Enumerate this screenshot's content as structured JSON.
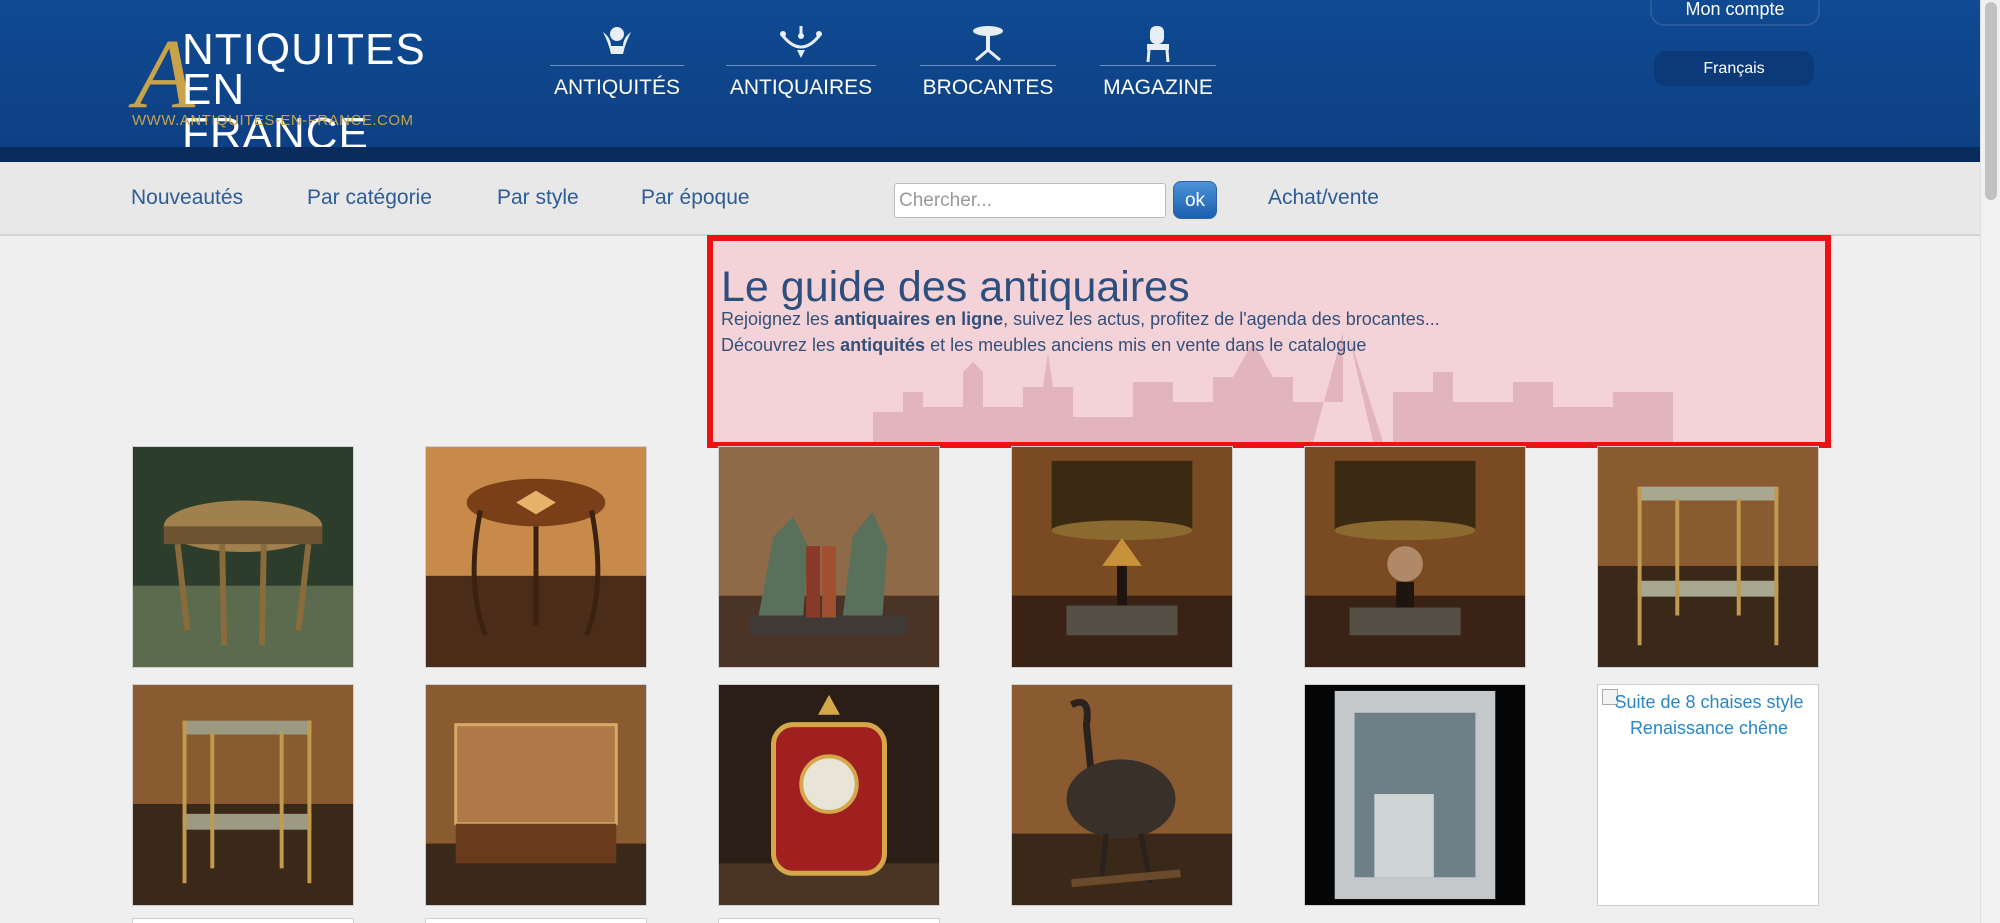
{
  "header": {
    "logo": {
      "initial": "A",
      "line1": "NTIQUITES",
      "line2": "EN FRANCE",
      "url": "WWW.ANTIQUITES-EN-FRANCE.COM"
    },
    "nav": [
      {
        "label": "ANTIQUITÉS",
        "icon": "cherub-icon"
      },
      {
        "label": "ANTIQUAIRES",
        "icon": "chandelier-icon"
      },
      {
        "label": "BROCANTES",
        "icon": "pedestal-table-icon"
      },
      {
        "label": "MAGAZINE",
        "icon": "chair-icon"
      }
    ],
    "account_label": "Mon compte",
    "language_label": "Français"
  },
  "subnav": {
    "items": [
      "Nouveautés",
      "Par catégorie",
      "Par style",
      "Par époque"
    ],
    "search_placeholder": "Chercher...",
    "search_button": "ok",
    "extra_link": "Achat/vente"
  },
  "intro": {
    "title": "Le guide des antiquaires",
    "line1": {
      "before": "Rejoignez les ",
      "bold": "antiquaires en ligne",
      "after": ", suivez les actus, profitez de l'agenda des brocantes..."
    },
    "line2": {
      "before": "Découvrez les ",
      "bold": "antiquités",
      "after": " et les meubles anciens mis en vente dans le catalogue"
    }
  },
  "products": {
    "row1": [
      {
        "icon": "round-table-icon"
      },
      {
        "icon": "gueridon-table-icon"
      },
      {
        "icon": "horse-bookends-icon"
      },
      {
        "icon": "lotus-lamp-icon"
      },
      {
        "icon": "ball-lamp-icon"
      },
      {
        "icon": "bamboo-side-table-icon"
      }
    ],
    "row2": [
      {
        "icon": "brass-side-table-icon"
      },
      {
        "icon": "display-cabinet-icon"
      },
      {
        "icon": "boulle-clock-icon"
      },
      {
        "icon": "ostrich-sculpture-icon"
      },
      {
        "icon": "silver-mirror-icon"
      },
      {
        "icon": "broken-image-icon",
        "alt": "Suite de 8 chaises style Renaissance chêne"
      }
    ]
  },
  "colors": {
    "header_blue": "#0f4a92",
    "gold": "#c9a24a",
    "link_blue": "#2d5c97",
    "highlight_red": "#ee1111"
  }
}
